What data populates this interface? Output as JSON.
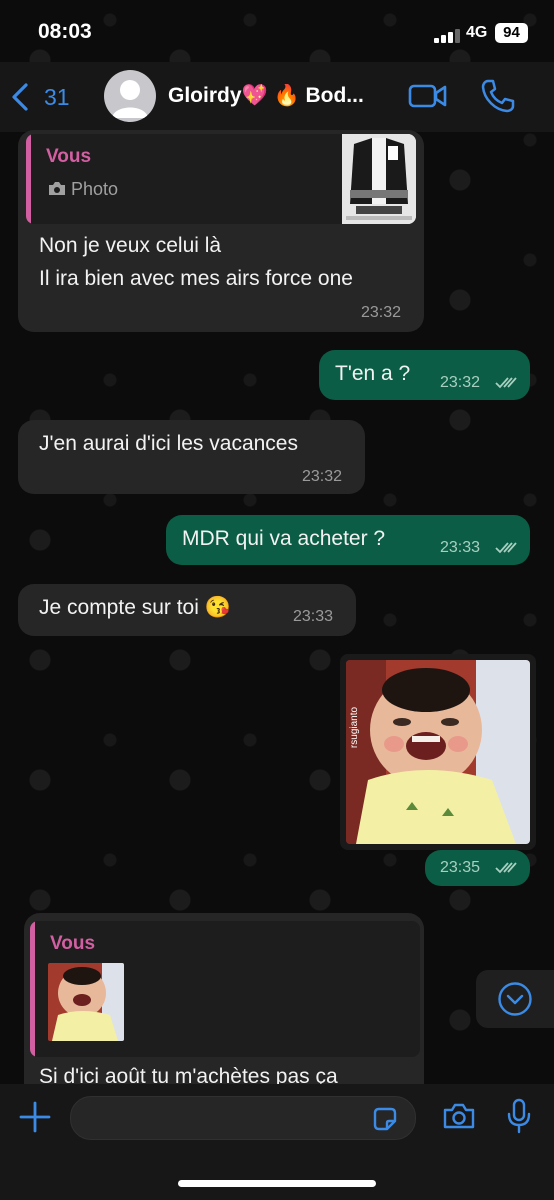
{
  "status_bar": {
    "time": "08:03",
    "network": "4G",
    "battery": "94"
  },
  "header": {
    "back_count": "31",
    "contact_name": "Gloirdy💖 🔥 Bod..."
  },
  "messages": [
    {
      "direction": "in",
      "reply": {
        "author": "Vous",
        "preview": "Photo"
      },
      "lines": [
        "Non je veux celui là",
        "Il ira bien avec mes airs force one"
      ],
      "time": "23:32"
    },
    {
      "direction": "out",
      "text": "T'en a ?",
      "time": "23:32"
    },
    {
      "direction": "in",
      "text": "J'en aurai d'ici les vacances",
      "time": "23:32"
    },
    {
      "direction": "out",
      "text": "MDR qui va acheter ?",
      "time": "23:33"
    },
    {
      "direction": "in",
      "text": "Je compte sur toi 😘",
      "time": "23:33"
    },
    {
      "direction": "out",
      "media": "photo",
      "watermark": "rsugianto",
      "time": "23:35"
    },
    {
      "direction": "in",
      "reply": {
        "author": "Vous",
        "preview": "photo"
      },
      "text": "Si d'ici août tu m'achètes pas ça",
      "time": ""
    }
  ],
  "icons": {
    "back": "chevron-left-icon",
    "video": "video-camera-icon",
    "call": "phone-icon",
    "scroll": "chevron-down-circle-icon",
    "plus": "plus-icon",
    "sticker": "sticker-icon",
    "camera": "camera-icon",
    "mic": "microphone-icon"
  },
  "colors": {
    "accent": "#3b8be6",
    "outgoing_bubble": "#0b5d45",
    "incoming_bubble": "#262626",
    "reply_author": "#d25fa1",
    "background": "#0b0b0b"
  }
}
